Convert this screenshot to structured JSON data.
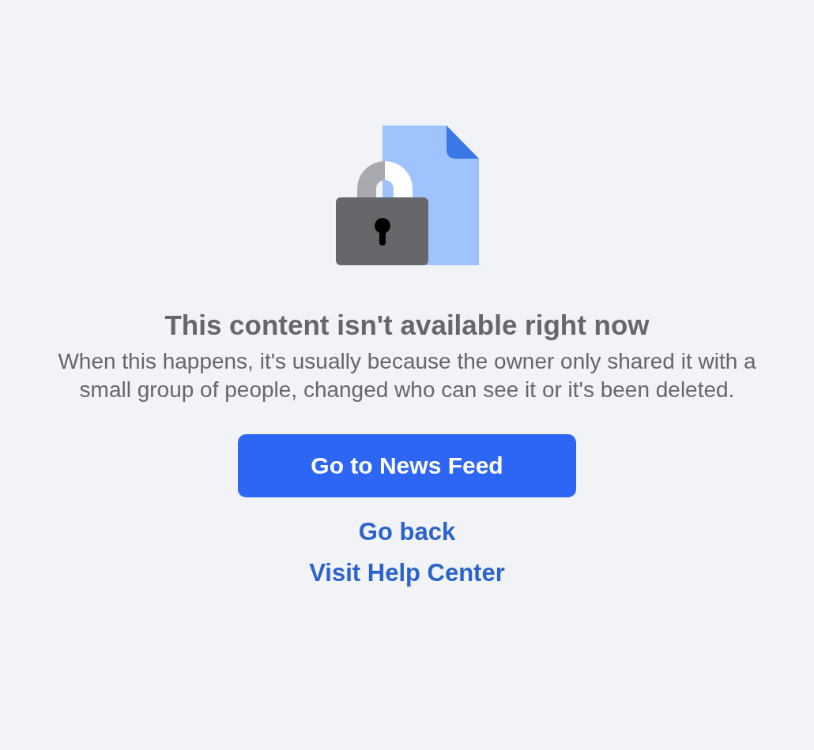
{
  "title": "This content isn't available right now",
  "message": "When this happens, it's usually because the owner only shared it with a small group of people, changed who can see it or it's been deleted.",
  "primary_button": "Go to News Feed",
  "links": [
    "Go back",
    "Visit Help Center"
  ]
}
